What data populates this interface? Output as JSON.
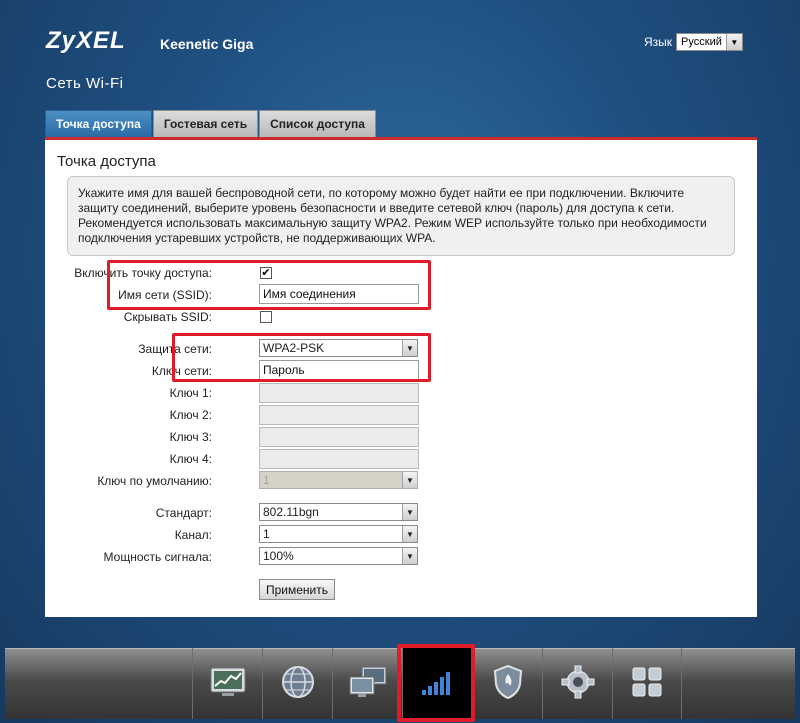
{
  "header": {
    "brand": "ZyXEL",
    "model": "Keenetic Giga",
    "language_label": "Язык",
    "language_value": "Русский"
  },
  "page_title": "Сеть Wi-Fi",
  "tabs": [
    {
      "label": "Точка доступа",
      "active": true
    },
    {
      "label": "Гостевая сеть",
      "active": false
    },
    {
      "label": "Список доступа",
      "active": false
    }
  ],
  "panel": {
    "heading": "Точка доступа",
    "info_text": "Укажите имя для вашей беспроводной сети, по которому можно будет найти ее при подключении. Включите защиту соединений, выберите уровень безопасности и введите сетевой ключ (пароль) для доступа к сети. Рекомендуется использовать максимальную защиту WPA2. Режим WEP используйте только при необходимости подключения устаревших устройств, не поддерживающих WPA."
  },
  "form": {
    "enable_ap": {
      "label": "Включить точку доступа:",
      "checked": true,
      "mark": "✔"
    },
    "ssid": {
      "label": "Имя сети (SSID):",
      "value": "Имя соединения"
    },
    "hide_ssid": {
      "label": "Скрывать SSID:",
      "checked": false
    },
    "security": {
      "label": "Защита сети:",
      "value": "WPA2-PSK"
    },
    "network_key": {
      "label": "Ключ сети:",
      "value": "Пароль"
    },
    "key1": {
      "label": "Ключ 1:",
      "value": ""
    },
    "key2": {
      "label": "Ключ 2:",
      "value": ""
    },
    "key3": {
      "label": "Ключ 3:",
      "value": ""
    },
    "key4": {
      "label": "Ключ 4:",
      "value": ""
    },
    "default_key": {
      "label": "Ключ по умолчанию:",
      "value": "1"
    },
    "standard": {
      "label": "Стандарт:",
      "value": "802.11bgn"
    },
    "channel": {
      "label": "Канал:",
      "value": "1"
    },
    "power": {
      "label": "Мощность сигнала:",
      "value": "100%"
    },
    "apply_label": "Применить"
  },
  "bottom_nav": [
    {
      "icon": "chart-monitor-icon",
      "active": false
    },
    {
      "icon": "globe-icon",
      "active": false
    },
    {
      "icon": "computers-icon",
      "active": false
    },
    {
      "icon": "wifi-signal-icon",
      "active": true
    },
    {
      "icon": "shield-icon",
      "active": false
    },
    {
      "icon": "gear-icon",
      "active": false
    },
    {
      "icon": "apps-grid-icon",
      "active": false
    }
  ],
  "colors": {
    "highlight": "#e01c2a",
    "tab_active": "#2a6ba5",
    "panel_border": "#cc2b2b"
  }
}
